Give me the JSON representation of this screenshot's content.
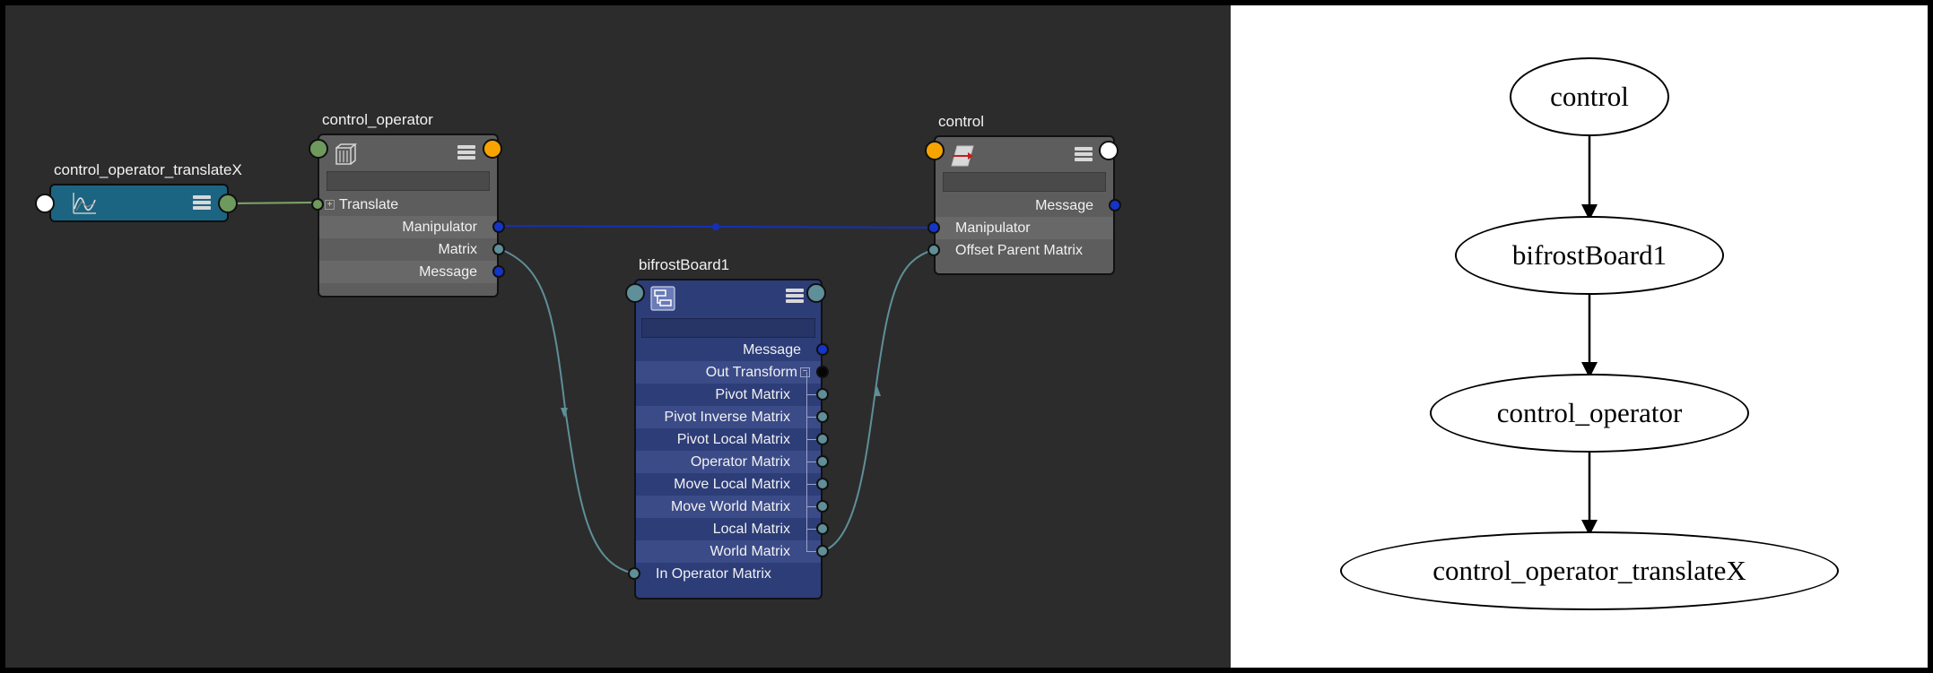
{
  "node_editor": {
    "nodes": {
      "translateX": {
        "title": "control_operator_translateX",
        "icon": "anim-curve-icon"
      },
      "control_operator": {
        "title": "control_operator",
        "icon": "bifrost-operator-icon",
        "rows": [
          "Translate",
          "Manipulator",
          "Matrix",
          "Message"
        ]
      },
      "control": {
        "title": "control",
        "icon": "transform-icon",
        "rows": [
          "Message",
          "Manipulator",
          "Offset Parent Matrix"
        ]
      },
      "bifrostBoard": {
        "title": "bifrostBoard1",
        "icon": "bifrost-board-icon",
        "rows": [
          "Message",
          "Out Transform",
          "Pivot Matrix",
          "Pivot Inverse Matrix",
          "Pivot Local Matrix",
          "Operator Matrix",
          "Move Local Matrix",
          "Move World Matrix",
          "Local Matrix",
          "World Matrix",
          "In Operator Matrix"
        ]
      }
    },
    "colors": {
      "editor_bg": "#2c2c2c",
      "node_gray": "#5d5d5d",
      "node_blue": "#2d3d78",
      "node_teal": "#1b6482",
      "plug_blue": "#1535c8",
      "plug_teal": "#5f8f98",
      "plug_green": "#6f9a5e",
      "plug_orange": "#f7a400",
      "wire_matrix": "#5f8f98",
      "wire_message": "#1530b8"
    }
  },
  "graph": {
    "nodes": [
      "control",
      "bifrostBoard1",
      "control_operator",
      "control_operator_translateX"
    ]
  }
}
